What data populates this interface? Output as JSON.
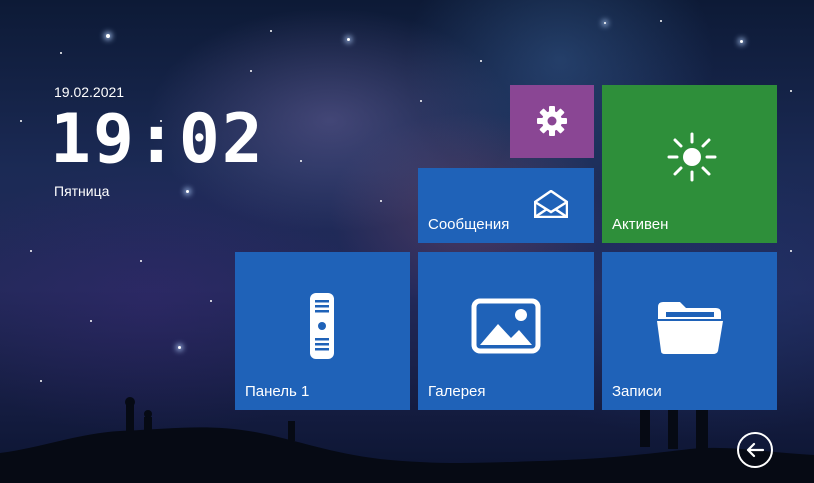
{
  "status": {
    "date": "19.02.2021",
    "time": "19:02",
    "weekday": "Пятница"
  },
  "tiles": {
    "settings": {
      "icon": "gear-icon"
    },
    "messages": {
      "label": "Сообщения",
      "icon": "envelope-icon"
    },
    "active": {
      "label": "Активен",
      "icon": "sun-icon"
    },
    "panel": {
      "label": "Панель 1",
      "icon": "door-panel-icon"
    },
    "gallery": {
      "label": "Галерея",
      "icon": "image-icon"
    },
    "records": {
      "label": "Записи",
      "icon": "folder-icon"
    }
  },
  "colors": {
    "tile_blue": "#1f62b8",
    "tile_green": "#2e8f3a",
    "tile_purple": "#8a4694"
  },
  "nav": {
    "back_icon": "back-arrow-icon"
  }
}
